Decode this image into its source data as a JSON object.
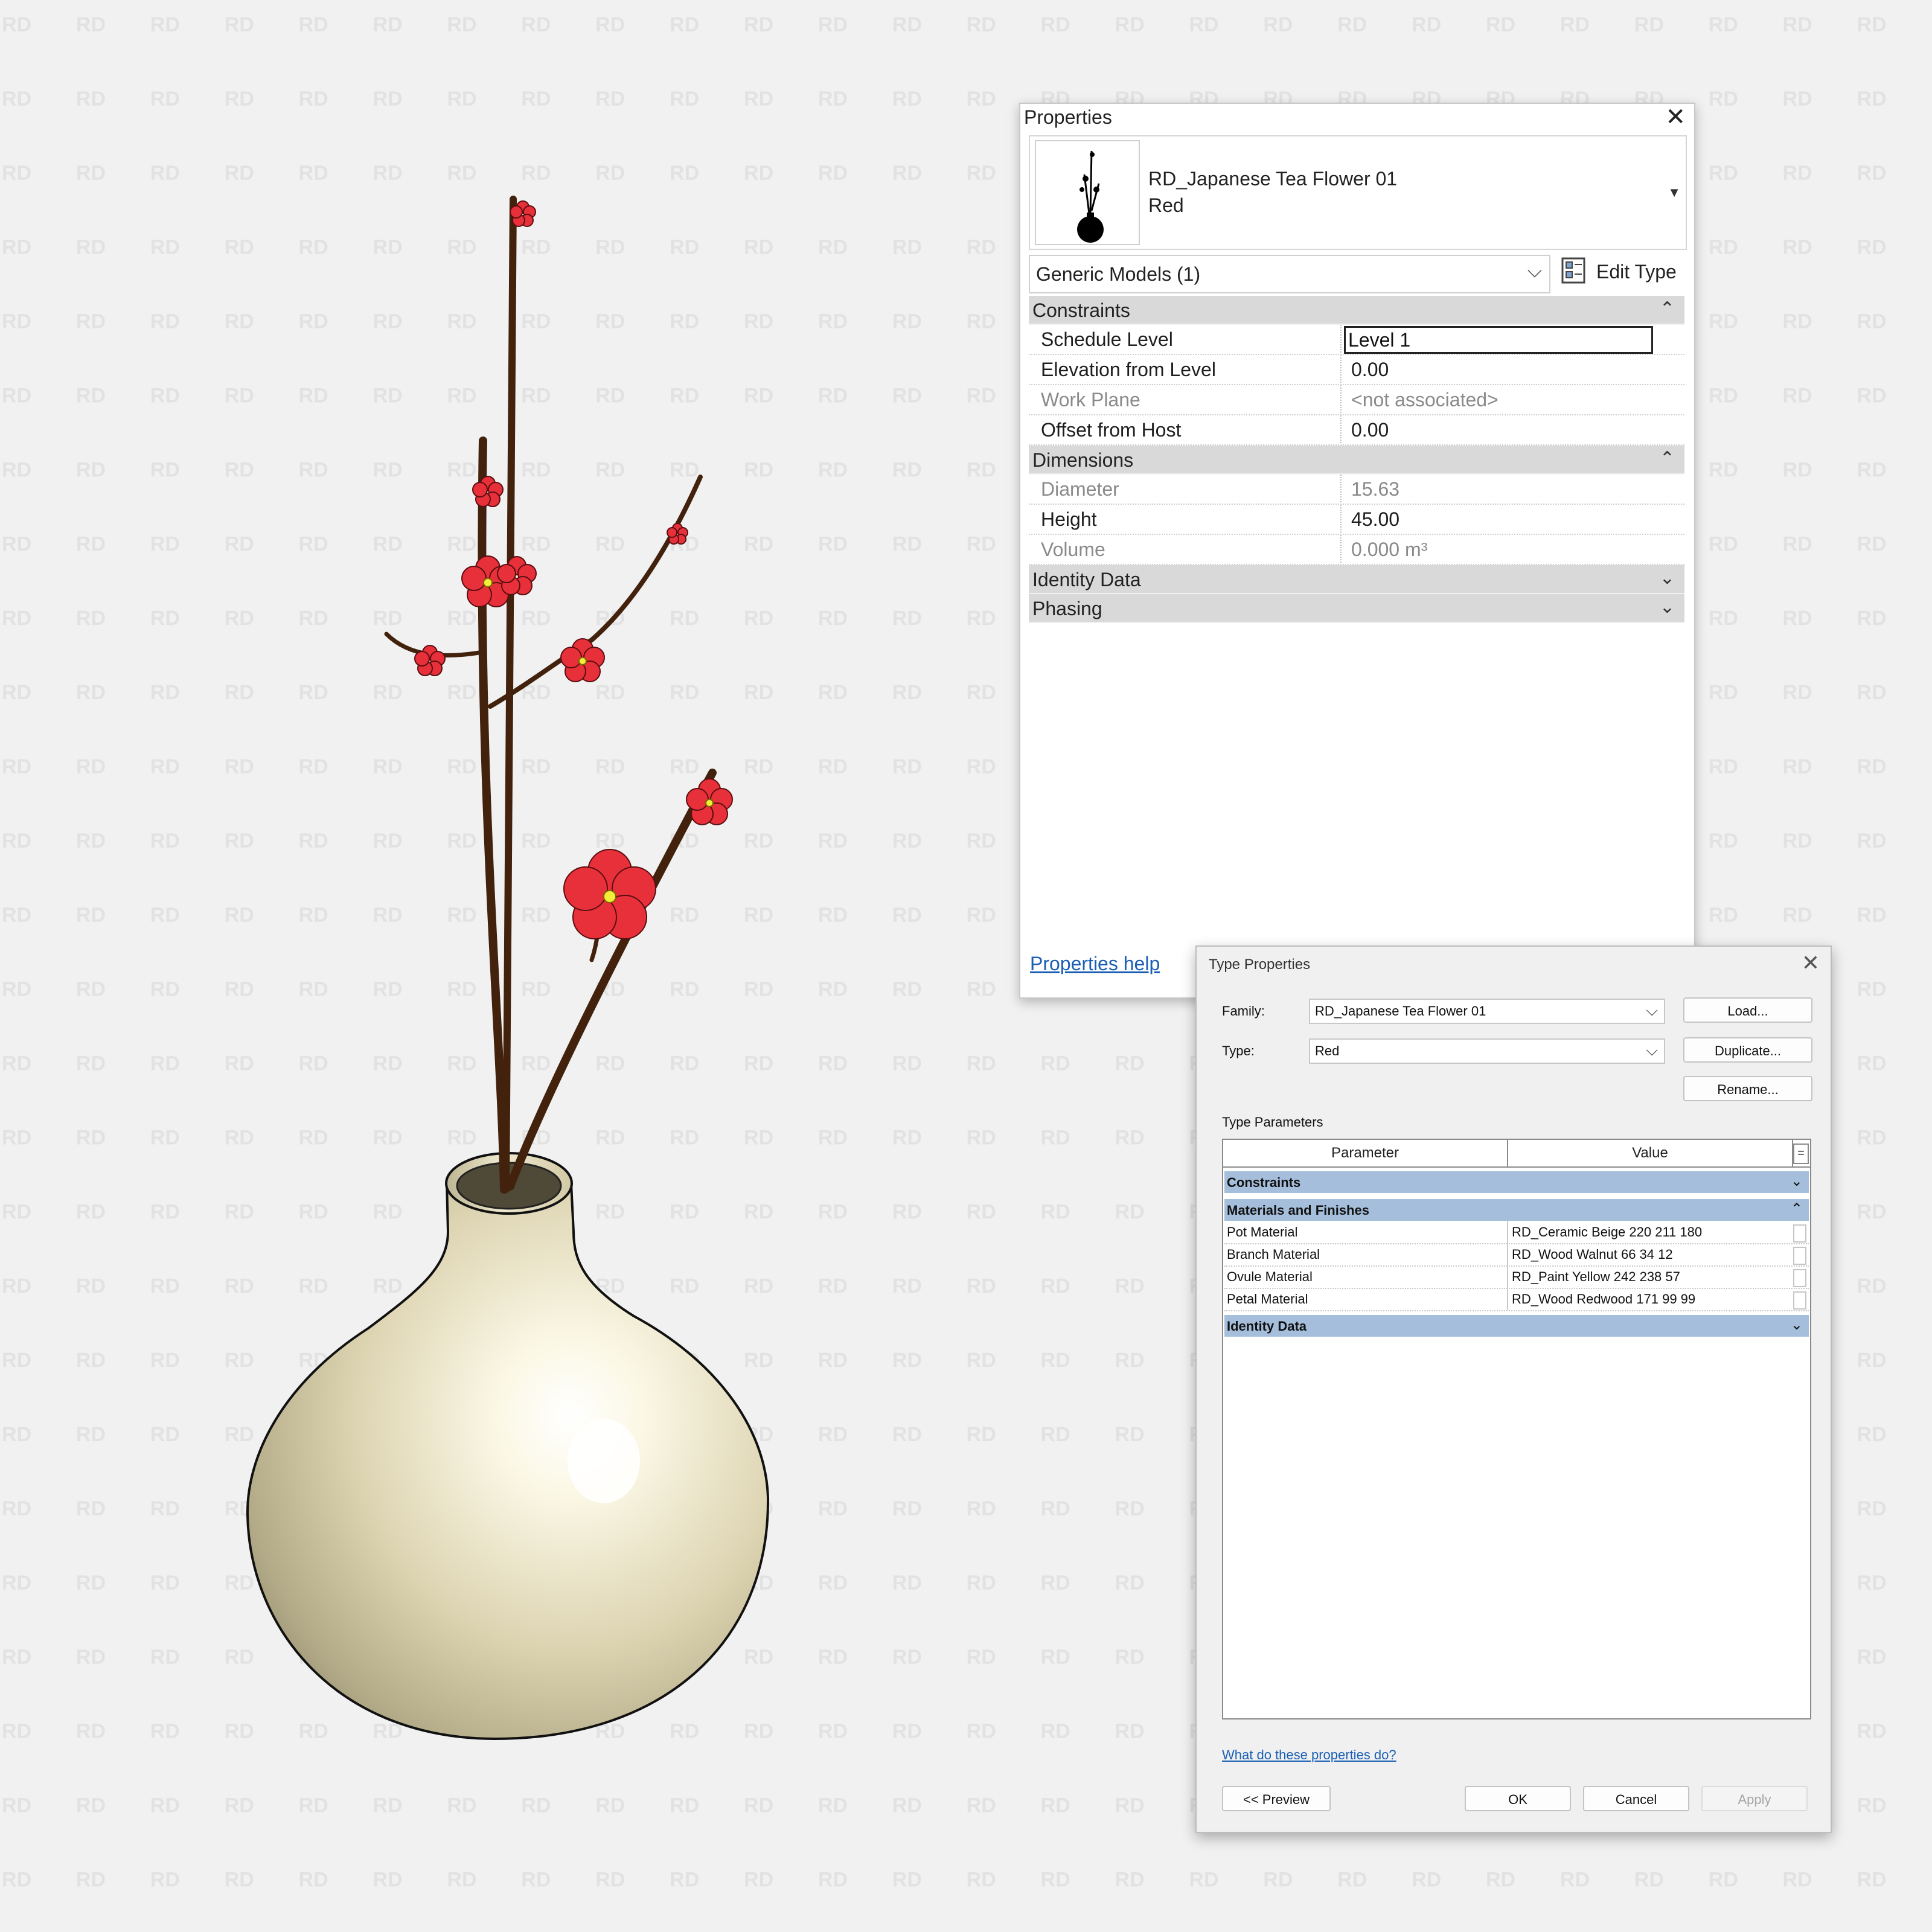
{
  "properties_palette": {
    "title": "Properties",
    "close_glyph": "✕",
    "type_selector": {
      "family": "RD_Japanese Tea Flower 01",
      "type": "Red",
      "arrow_glyph": "▼",
      "thumbnail_icon": "vase-thumbnail-icon"
    },
    "category_filter": "Generic Models (1)",
    "edit_type_label": "Edit Type",
    "groups": {
      "constraints": {
        "label": "Constraints",
        "collapsed": false
      },
      "dimensions": {
        "label": "Dimensions",
        "collapsed": false
      },
      "identity": {
        "label": "Identity Data",
        "collapsed": true
      },
      "phasing": {
        "label": "Phasing",
        "collapsed": true
      }
    },
    "constraints_rows": [
      {
        "name": "Schedule Level",
        "value": "Level 1",
        "editing": true
      },
      {
        "name": "Elevation from Level",
        "value": "0.00"
      },
      {
        "name": "Work Plane",
        "value": "<not associated>",
        "disabled": true
      },
      {
        "name": "Offset from Host",
        "value": "0.00"
      }
    ],
    "dimensions_rows": [
      {
        "name": "Diameter",
        "value": "15.63",
        "disabled": true
      },
      {
        "name": "Height",
        "value": "45.00"
      },
      {
        "name": "Volume",
        "value": "0.000 m³",
        "disabled": true
      }
    ],
    "help_link": "Properties help"
  },
  "type_properties_dialog": {
    "title": "Type Properties",
    "close_glyph": "✕",
    "family_label": "Family:",
    "family_value": "RD_Japanese Tea Flower 01",
    "type_label": "Type:",
    "type_value": "Red",
    "buttons": {
      "load": "Load...",
      "duplicate": "Duplicate...",
      "rename": "Rename...",
      "preview": "<< Preview",
      "ok": "OK",
      "cancel": "Cancel",
      "apply": "Apply"
    },
    "type_parameters_label": "Type Parameters",
    "table_headers": {
      "parameter": "Parameter",
      "value": "Value",
      "toggle": "="
    },
    "groups": {
      "constraints": "Constraints",
      "materials": "Materials and Finishes",
      "identity": "Identity Data"
    },
    "material_rows": [
      {
        "parameter": "Pot Material",
        "value": "RD_Ceramic Beige 220 211 180"
      },
      {
        "parameter": "Branch Material",
        "value": "RD_Wood Walnut 66 34 12"
      },
      {
        "parameter": "Ovule Material",
        "value": "RD_Paint Yellow 242 238 57"
      },
      {
        "parameter": "Petal Material",
        "value": "RD_Wood Redwood 171 99 99"
      }
    ],
    "help_link": "What do these properties do?"
  },
  "watermark_text": "RD",
  "colors": {
    "pot": "#dcd3b4",
    "branch": "#42220c",
    "petal": "#e8303a",
    "ovule": "#f2ee39",
    "link": "#1a5fb4",
    "group_header_blue": "#a4bedb"
  },
  "icons": [
    "close-icon",
    "dropdown-arrow-icon",
    "edit-type-icon",
    "collapse-icon",
    "expand-icon",
    "vase-thumbnail-icon"
  ]
}
